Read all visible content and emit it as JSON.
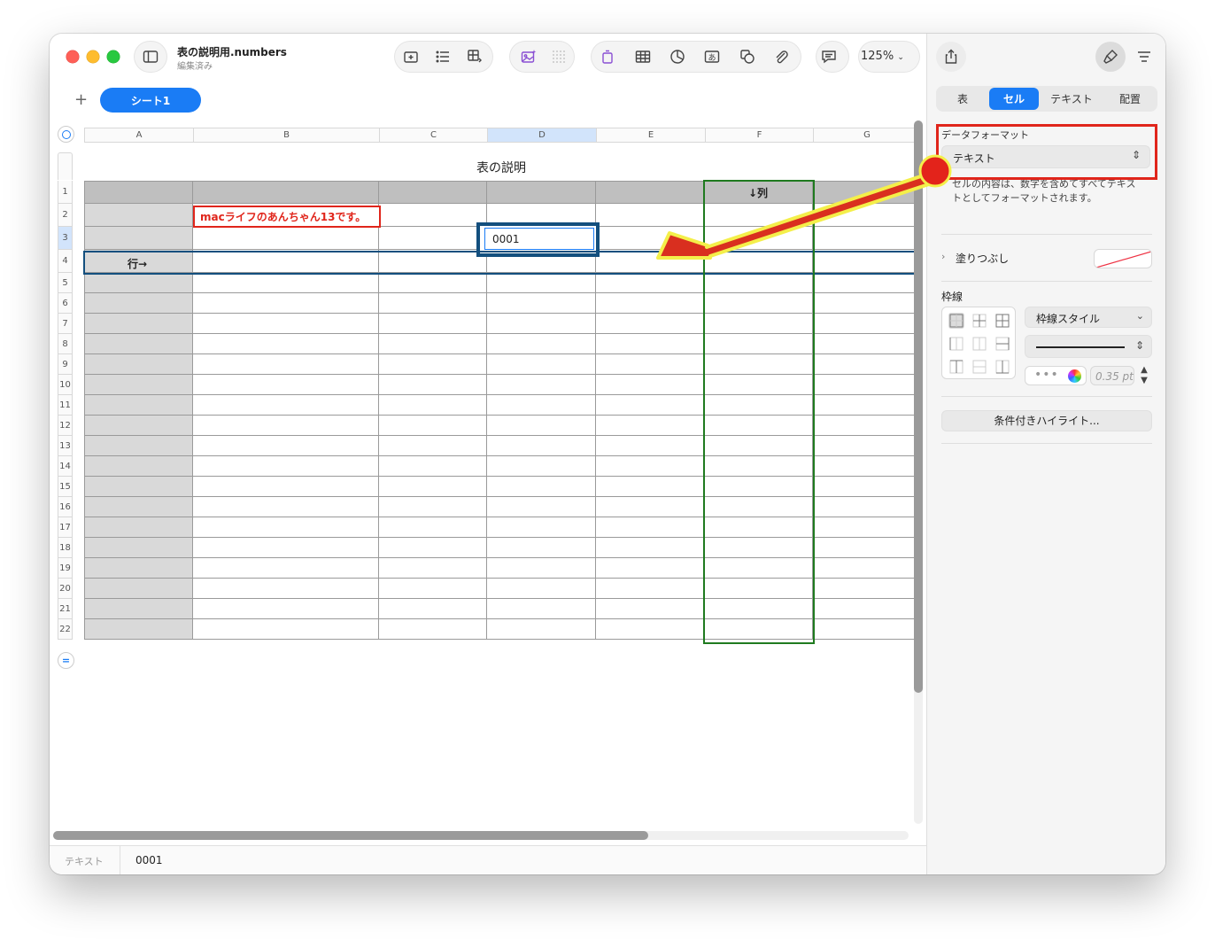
{
  "window": {
    "title": "表の説明用.numbers",
    "subtitle": "編集済み",
    "zoom": "125%"
  },
  "sheets": {
    "add": "+",
    "active": "シート1"
  },
  "columns": [
    "A",
    "B",
    "C",
    "D",
    "E",
    "F",
    "G"
  ],
  "rows": [
    "1",
    "2",
    "3",
    "4",
    "5",
    "6",
    "7",
    "8",
    "9",
    "10",
    "11",
    "12",
    "13",
    "14",
    "15",
    "16",
    "17",
    "18",
    "19",
    "20",
    "21",
    "22"
  ],
  "table": {
    "title": "表の説明",
    "header_label": "↓列",
    "row_label": "行→",
    "annotation": "macライフのあんちゃん13です。",
    "selected_cell": {
      "ref": "D3",
      "value": "0001"
    }
  },
  "statusbar": {
    "format": "テキスト",
    "value": "0001"
  },
  "inspector": {
    "tabs": [
      "表",
      "セル",
      "テキスト",
      "配置"
    ],
    "active_tab": "セル",
    "data_format_label": "データフォーマット",
    "data_format_value": "テキスト",
    "data_format_desc": "セルの内容は、数字を含めてすべてテキストとしてフォーマットされます。",
    "fill_label": "塗りつぶし",
    "border_label": "枠線",
    "border_style": "枠線スタイル",
    "border_width": "0.35 pt",
    "conditional_button": "条件付きハイライト..."
  },
  "colors": {
    "accent": "#1a7cf5",
    "annotation_red": "#e0251b",
    "selection_blue": "#134f7e",
    "column_green": "#1f7a1f",
    "arrow_red": "#d92f1f",
    "arrow_outline": "#f4ef4a"
  }
}
